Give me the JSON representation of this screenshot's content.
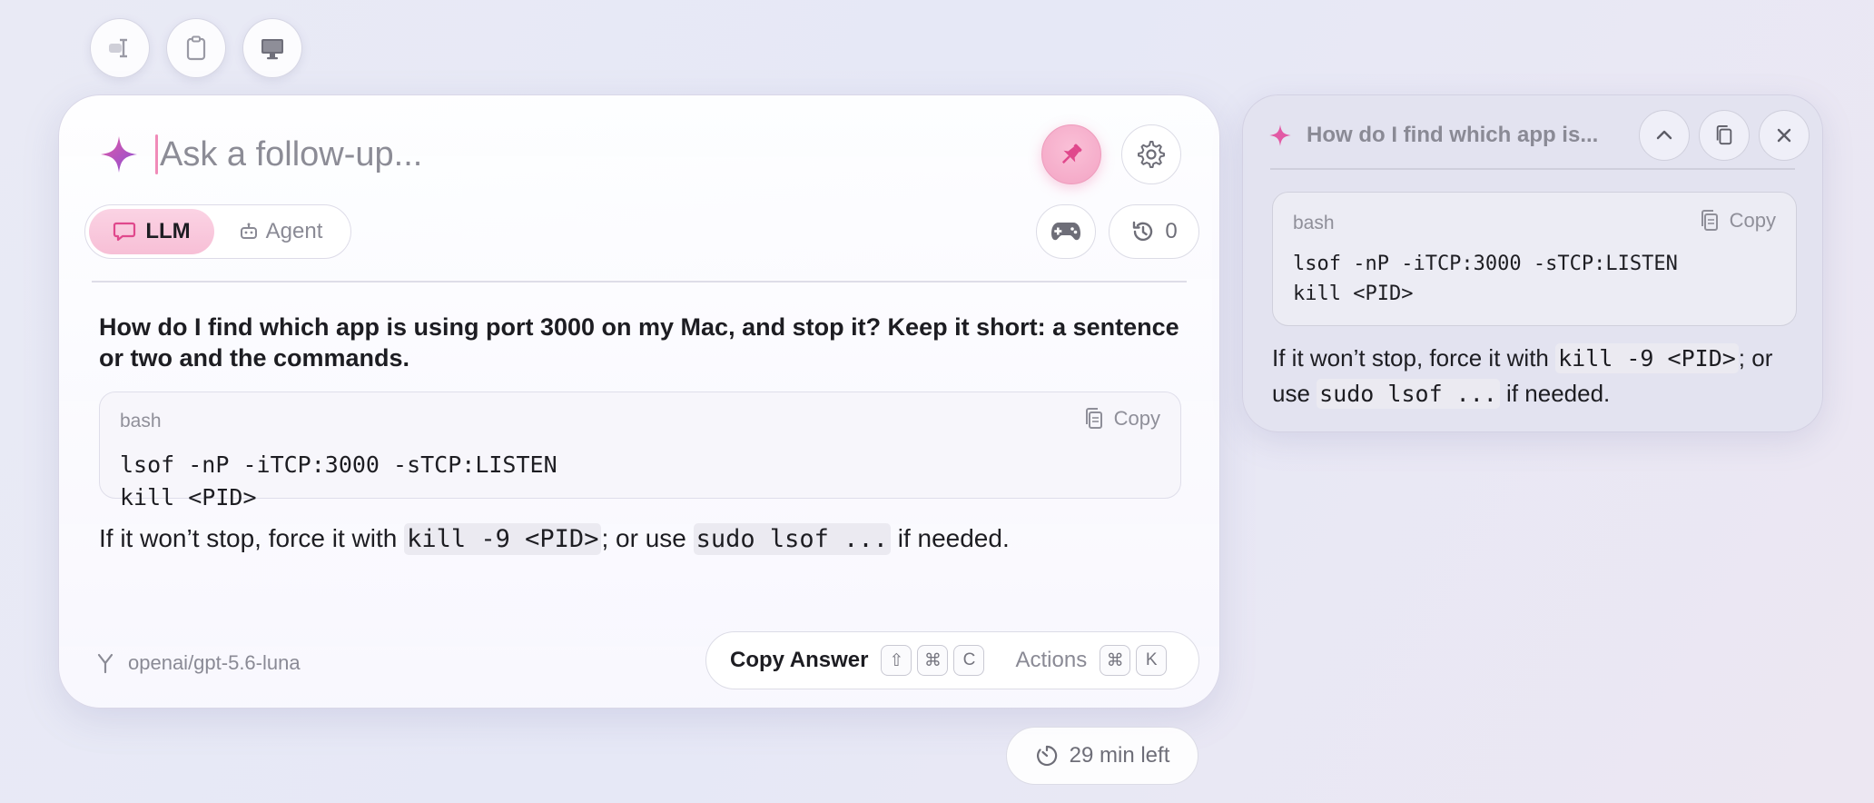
{
  "toolbar": {
    "icons": [
      "text-cursor-icon",
      "clipboard-icon",
      "monitor-icon"
    ]
  },
  "main": {
    "ask_placeholder": "Ask a follow-up...",
    "mode_llm": "LLM",
    "mode_agent": "Agent",
    "history_count": "0",
    "question": "How do I find which app is using port 3000 on my Mac, and stop it? Keep it short: a sentence or two and the commands.",
    "code": {
      "lang": "bash",
      "copy_label": "Copy",
      "line1": "lsof -nP -iTCP:3000 -sTCP:LISTEN",
      "line2": "kill <PID>"
    },
    "answer": {
      "part1": "If it won’t stop, force it with ",
      "code1": "kill -9 <PID>",
      "part2": "; or use ",
      "code2": "sudo lsof ...",
      "part3": " if needed."
    },
    "model": "openai/gpt-5.6-luna",
    "copy_answer_label": "Copy Answer",
    "copy_shortcut": [
      "⇧",
      "⌘",
      "C"
    ],
    "actions_label": "Actions",
    "actions_shortcut": [
      "⌘",
      "K"
    ],
    "accent_pink": "#f3a4c4"
  },
  "timer": {
    "label": "29 min left"
  },
  "mini": {
    "title": "How do I find which app is...",
    "code": {
      "lang": "bash",
      "copy_label": "Copy",
      "line1": "lsof -nP -iTCP:3000 -sTCP:LISTEN",
      "line2": "kill <PID>"
    },
    "answer": {
      "part1": "If it won’t stop, force it with ",
      "code1": "kill -9 <PID>",
      "part2": "; or use ",
      "code2": "sudo lsof ...",
      "part3": " if needed."
    }
  }
}
